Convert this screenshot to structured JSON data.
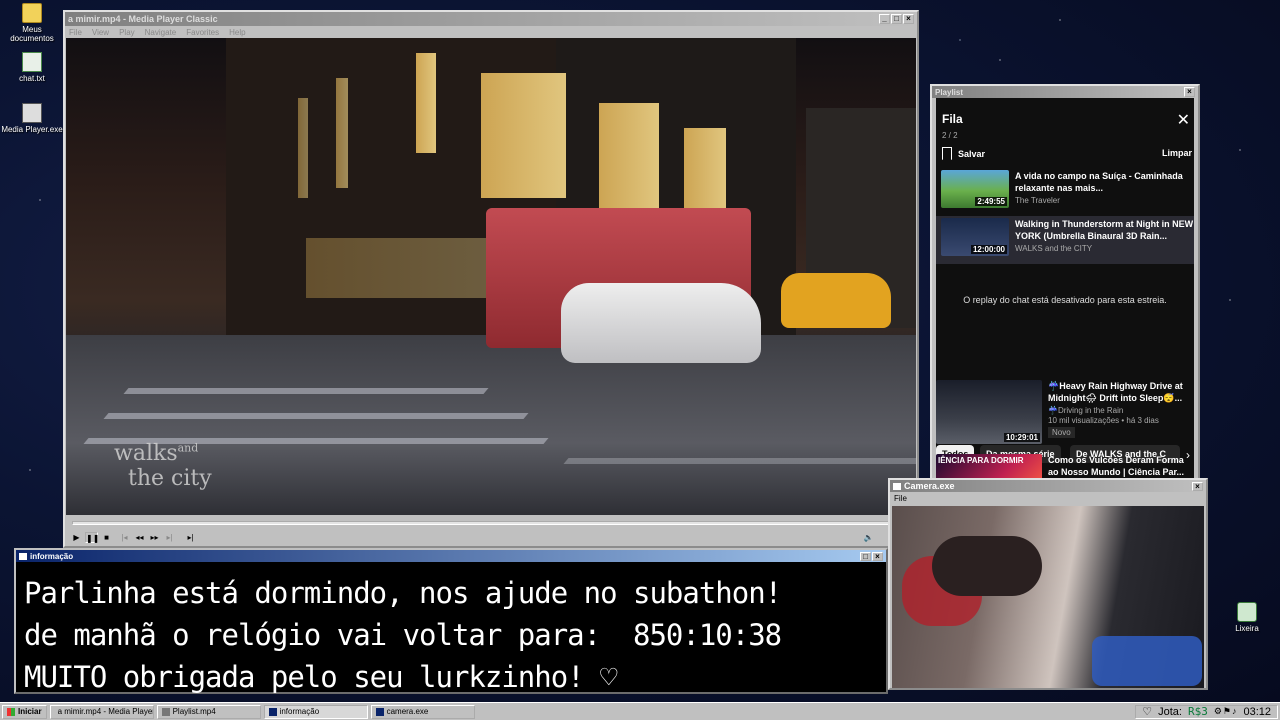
{
  "desktop": {
    "icons": [
      {
        "label": "Meus documentos"
      },
      {
        "label": "chat.txt"
      },
      {
        "label": "Media Player.exe"
      },
      {
        "label": "Lixeira"
      }
    ]
  },
  "player": {
    "title": "a mimir.mp4 - Media Player Classic",
    "menu": [
      "File",
      "View",
      "Play",
      "Navigate",
      "Favorites",
      "Help"
    ],
    "watermark_line1": "walks",
    "watermark_and": "and",
    "watermark_line2": "the city",
    "controls": [
      "play",
      "pause",
      "stop",
      "prev",
      "rewind",
      "forward",
      "next",
      "frame-step"
    ]
  },
  "playlist": {
    "window_title": "Playlist",
    "header": "Fila",
    "count": "2 / 2",
    "save_label": "Salvar",
    "clear_label": "Limpar",
    "items": [
      {
        "title": "A vida no campo na Suíça - Caminhada relaxante nas mais...",
        "channel": "The Traveler",
        "duration": "2:49:55"
      },
      {
        "title": "Walking in Thunderstorm at Night in NEW YORK (Umbrella Binaural 3D Rain...",
        "channel": "WALKS and the CITY",
        "duration": "12:00:00"
      }
    ],
    "chat_disabled": "O replay do chat está desativado para esta estreia.",
    "chips": [
      "Todos",
      "Da mesma série",
      "De WALKS and the C"
    ],
    "recs": [
      {
        "title": "☔Heavy Rain Highway Drive at Midnight🌧 Drift into Sleep😴...",
        "channel": "☔Driving in the Rain",
        "meta": "10 mil visualizações • há 3 dias",
        "badge": "Novo",
        "duration": "10:29:01"
      },
      {
        "title": "Como os Vulcões Deram Forma ao Nosso Mundo | Ciência Par...",
        "thumb_text": "IÊNCIA PARA DORMIR"
      }
    ]
  },
  "info": {
    "title": "informação",
    "lines": [
      "Parlinha está dormindo, nos ajude no subathon!",
      "de manhã o relógio vai voltar para:  850:10:38",
      "MUITO obrigada pelo seu lurkzinho! ♡"
    ]
  },
  "camera": {
    "title": "Camera.exe",
    "menu": [
      "File"
    ]
  },
  "taskbar": {
    "start": "Iniciar",
    "tasks": [
      "a mimir.mp4 - Media Player...",
      "Playlist.mp4",
      "informação",
      "camera.exe"
    ],
    "tray_text": "Jota:",
    "tray_currency": "R$3",
    "clock": "03:12"
  }
}
